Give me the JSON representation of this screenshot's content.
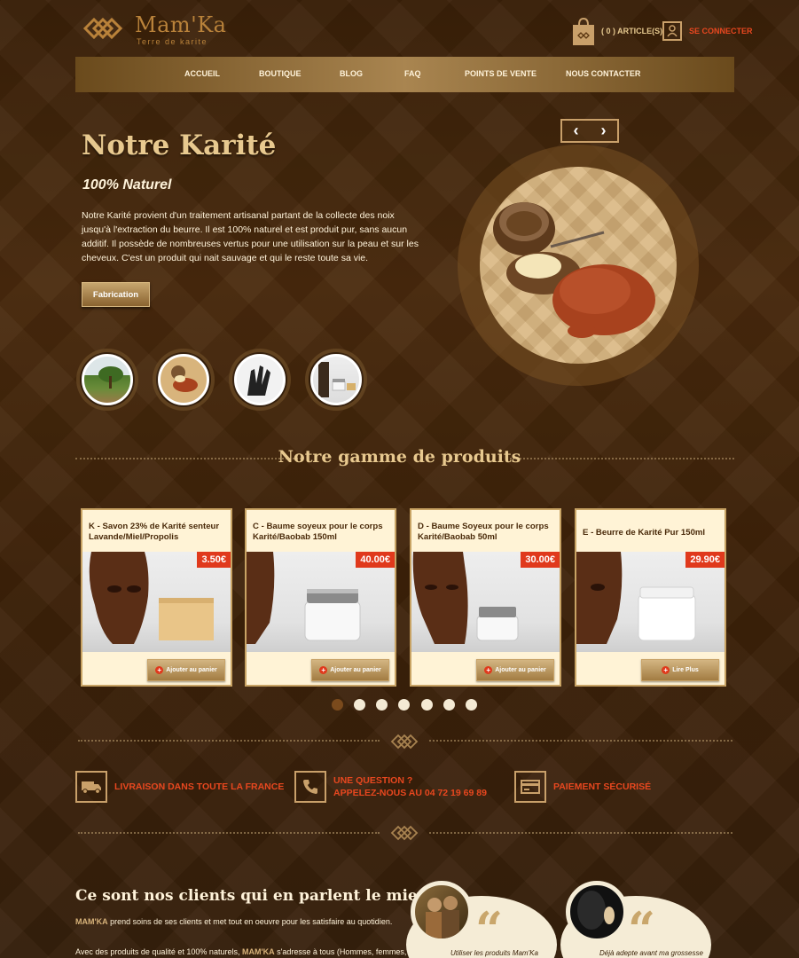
{
  "header": {
    "logo_name": "Mam'Ka",
    "logo_tagline": "Terre de karite",
    "cart_label": "( 0 ) ARTICLE(S)",
    "login_label": "SE CONNECTER"
  },
  "nav": {
    "items": [
      "ACCUEIL",
      "BOUTIQUE",
      "BLOG",
      "FAQ",
      "POINTS DE VENTE",
      "NOUS CONTACTER"
    ]
  },
  "hero": {
    "title": "Notre Karité",
    "subtitle": "100% Naturel",
    "text": "Notre Karité provient d'un traitement artisanal partant de la collecte des noix jusqu'à l'extraction du beurre. Il est 100% naturel et est produit pur, sans aucun additif. Il possède de nombreuses vertus pour une utilisation sur la peau et sur les cheveux. C'est un produit qui nait sauvage et qui le reste toute sa vie.",
    "button": "Fabrication"
  },
  "products": {
    "section_title": "Notre gamme de produits",
    "items": [
      {
        "title": "K - Savon 23% de Karité senteur Lavande/Miel/Propolis",
        "price": "3.50€",
        "button": "Ajouter au panier"
      },
      {
        "title": "C - Baume soyeux pour le corps Karité/Baobab 150ml",
        "price": "40.00€",
        "button": "Ajouter au panier"
      },
      {
        "title": "D - Baume Soyeux pour le corps Karité/Baobab 50ml",
        "price": "30.00€",
        "button": "Ajouter au panier"
      },
      {
        "title": "E - Beurre de Karité Pur 150ml",
        "price": "29.90€",
        "button": "Lire Plus"
      }
    ],
    "pagination_count": 7,
    "pagination_active": 1
  },
  "features": {
    "delivery": "LIVRAISON DANS TOUTE LA FRANCE",
    "question_line1": "UNE QUESTION ?",
    "question_line2": "APPELEZ-NOUS AU 04 72 19 69 89",
    "payment": "PAIEMENT SÉCURISÉ"
  },
  "testimonials": {
    "title": "Ce sont nos clients qui en parlent le mieux...",
    "brand": "MAM'KA",
    "p1_rest": " prend soins de ses clients et met tout en oeuvre pour les satisfaire au quotidien.",
    "p2_start": "Avec des produits de qualité et 100% naturels, ",
    "p2_rest": " s'adresse à tous (Hommes, femmes,",
    "quote1": "Utiliser les produits Mam'Ka",
    "quote2": "Déjà adepte avant ma grossesse"
  },
  "colors": {
    "accent_red": "#e8471f",
    "gold": "#c9a06a",
    "cream": "#fff3d6"
  }
}
